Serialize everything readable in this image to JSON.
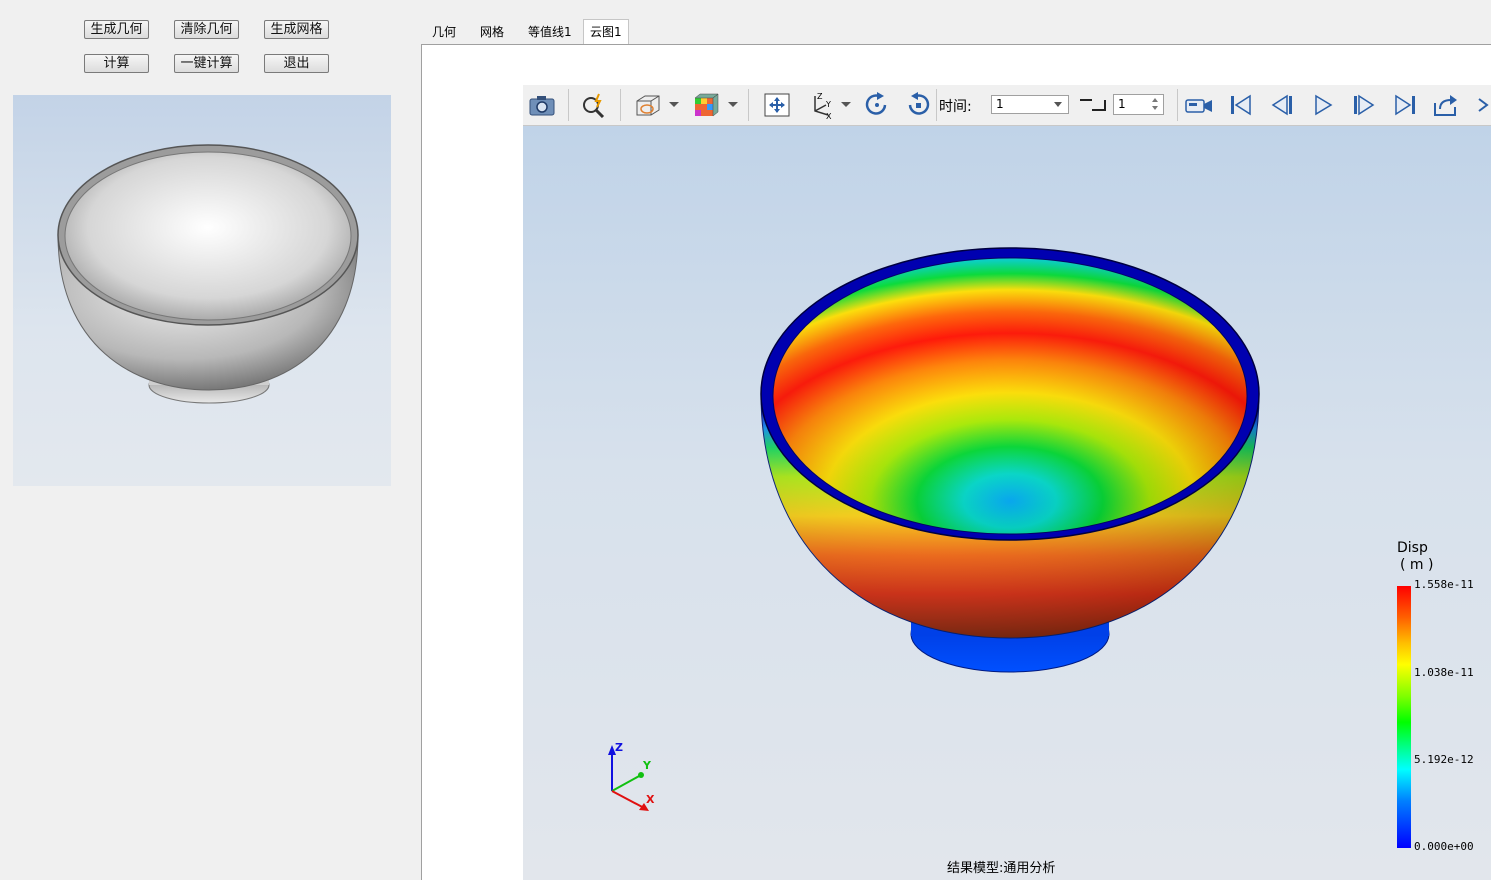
{
  "left_panel": {
    "buttons": {
      "gen_geometry": "生成几何",
      "clear_geometry": "清除几何",
      "gen_mesh": "生成网格",
      "compute": "计算",
      "one_click_compute": "一键计算",
      "exit": "退出"
    }
  },
  "tabs": [
    {
      "label": "几何",
      "active": false
    },
    {
      "label": "网格",
      "active": false
    },
    {
      "label": "等值线1",
      "active": false
    },
    {
      "label": "云图1",
      "active": true
    }
  ],
  "toolbar": {
    "time_label": "时间:",
    "time_value": "1",
    "step_value": "1",
    "icons": [
      "camera-icon",
      "zoom-icon",
      "clip-box-icon",
      "colormap-cube-icon",
      "fit-view-icon",
      "axes-orient-icon",
      "rotate-cw-icon",
      "rotate-ccw-icon",
      "record-icon",
      "first-frame-icon",
      "prev-frame-icon",
      "play-icon",
      "next-frame-icon",
      "last-frame-icon",
      "export-icon"
    ]
  },
  "legend": {
    "title": "Disp",
    "unit": "( m )",
    "ticks": [
      "1.558e-11",
      "1.038e-11",
      "5.192e-12",
      "0.000e+00"
    ],
    "max": 1.558e-11,
    "min": 0.0
  },
  "axes": {
    "z": "Z",
    "y": "Y",
    "x": "X"
  },
  "status_text": "结果模型:通用分析",
  "colors": {
    "panel_bg": "#f0f0f0",
    "viewport_top": "#c0d3e8",
    "viewport_bottom": "#e2e6ec",
    "axis_x": "#e01010",
    "axis_y": "#10c010",
    "axis_z": "#1010e0"
  }
}
